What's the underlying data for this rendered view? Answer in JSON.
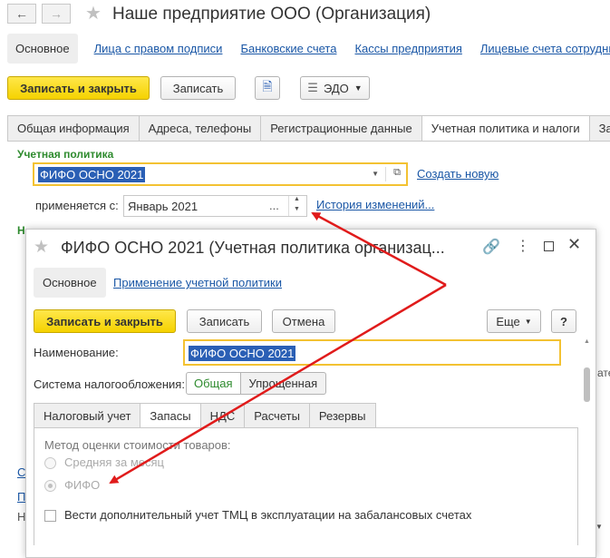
{
  "main": {
    "title": "Наше предприятие ООО (Организация)",
    "nav": [
      "Основное",
      "Лица с правом подписи",
      "Банковские счета",
      "Кассы предприятия",
      "Лицевые счета сотрудни"
    ],
    "toolbar": {
      "save_close": "Записать и закрыть",
      "save": "Записать",
      "edo": "ЭДО"
    },
    "tabs": [
      "Общая информация",
      "Адреса, телефоны",
      "Регистрационные данные",
      "Учетная политика и налоги",
      "Зарп"
    ],
    "policy_section": "Учетная политика",
    "policy_value": "ФИФО ОСНО 2021",
    "create_new": "Создать новую",
    "applies_from_label": "применяется с:",
    "applies_from_value": "Январь 2021",
    "history_link": "История изменений...",
    "ellipsis": "..."
  },
  "dialog": {
    "title": "ФИФО ОСНО 2021 (Учетная политика организац...",
    "nav_main": "Основное",
    "nav_link": "Применение учетной политики",
    "toolbar": {
      "save_close": "Записать и закрыть",
      "save": "Записать",
      "cancel": "Отмена",
      "more": "Еще",
      "help": "?"
    },
    "name_label": "Наименование:",
    "name_value": "ФИФО ОСНО 2021",
    "tax_label": "Система налогообложения:",
    "tax_options": [
      "Общая",
      "Упрощенная"
    ],
    "tabs": [
      "Налоговый учет",
      "Запасы",
      "НДС",
      "Расчеты",
      "Резервы"
    ],
    "method_label": "Метод оценки стоимости товаров:",
    "radio_options": [
      "Средняя за месяц",
      "ФИФО"
    ],
    "checkbox_label": "Вести дополнительный учет ТМЦ в эксплуатации на забалансовых счетах"
  },
  "colors": {
    "accent_yellow": "#f5d200",
    "link_blue": "#1a57a6",
    "green": "#2e8b2e",
    "arrow_red": "#e01b1b",
    "selection": "#2a5fb5"
  }
}
